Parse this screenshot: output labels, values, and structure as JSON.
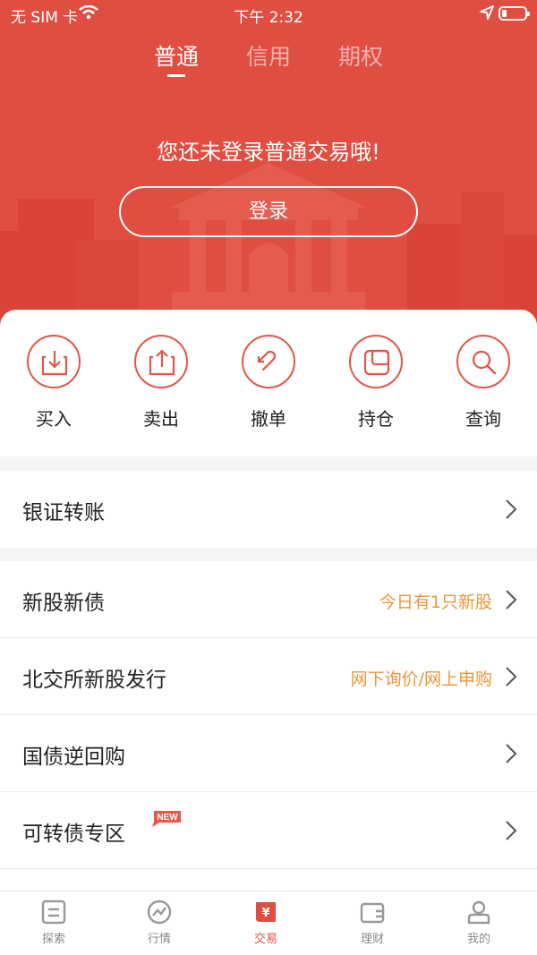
{
  "status_bar": {
    "carrier": "无 SIM 卡",
    "time": "下午 2:32"
  },
  "top_tabs": [
    {
      "label": "普通",
      "active": true
    },
    {
      "label": "信用",
      "active": false
    },
    {
      "label": "期权",
      "active": false
    }
  ],
  "login": {
    "message": "您还未登录普通交易哦!",
    "button": "登录"
  },
  "actions": [
    {
      "label": "买入",
      "icon": "buy-icon"
    },
    {
      "label": "卖出",
      "icon": "sell-icon"
    },
    {
      "label": "撤单",
      "icon": "cancel-order-icon"
    },
    {
      "label": "持仓",
      "icon": "position-icon"
    },
    {
      "label": "查询",
      "icon": "search-icon"
    }
  ],
  "rows": {
    "bank_transfer": {
      "title": "银证转账"
    },
    "ipo": {
      "title": "新股新债",
      "hint": "今日有1只新股"
    },
    "bse_ipo": {
      "title": "北交所新股发行",
      "hint": "网下询价/网上申购"
    },
    "repo": {
      "title": "国债逆回购"
    },
    "convertible": {
      "title": "可转债专区",
      "badge": "NEW"
    }
  },
  "tabbar": [
    {
      "label": "探索",
      "icon": "explore-icon",
      "active": false
    },
    {
      "label": "行情",
      "icon": "market-icon",
      "active": false
    },
    {
      "label": "交易",
      "icon": "trade-icon",
      "active": true
    },
    {
      "label": "理财",
      "icon": "wallet-icon",
      "active": false
    },
    {
      "label": "我的",
      "icon": "profile-icon",
      "active": false
    }
  ],
  "colors": {
    "brand": "#e04e42",
    "hint": "#e8973a"
  }
}
